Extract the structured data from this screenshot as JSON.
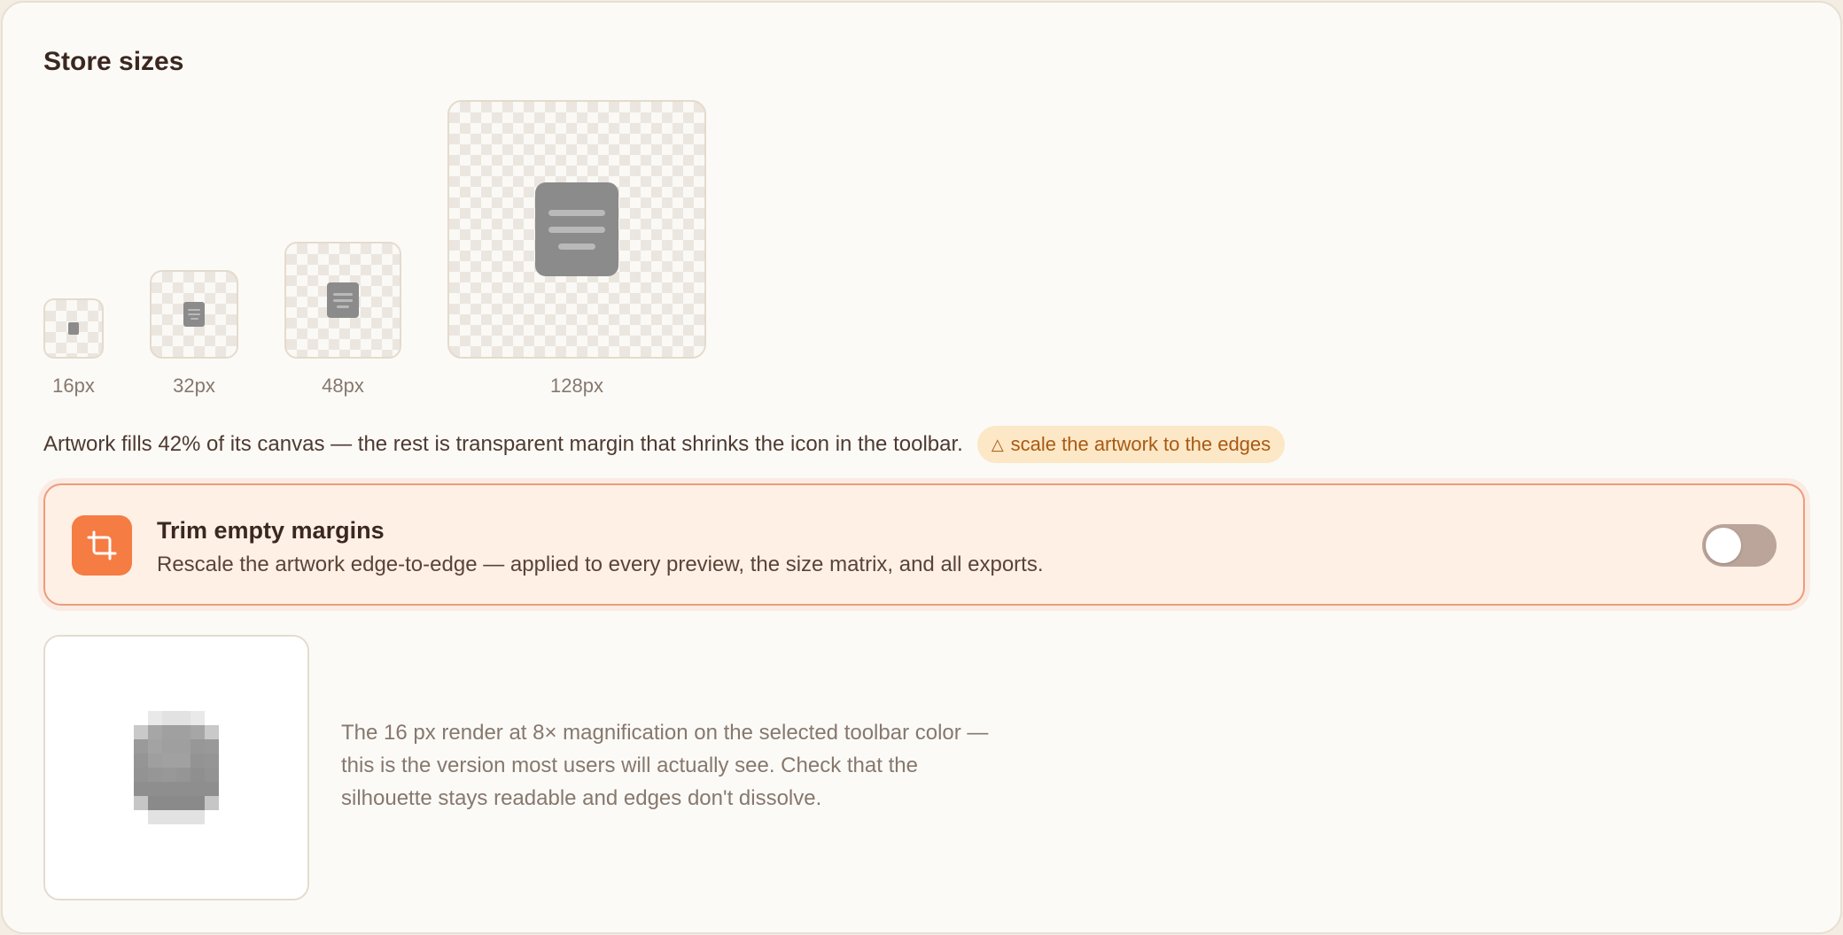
{
  "section": {
    "title": "Store sizes"
  },
  "sizes": [
    {
      "label": "16px"
    },
    {
      "label": "32px"
    },
    {
      "label": "48px"
    },
    {
      "label": "128px"
    }
  ],
  "notice": {
    "text": "Artwork fills 42% of its canvas — the rest is transparent margin that shrinks the icon in the toolbar.",
    "pill_icon": "△",
    "pill_label": "scale the artwork to the edges",
    "pill_color": "#a85a12",
    "pill_bg": "#fce7c6"
  },
  "trim": {
    "icon": "crop-icon",
    "title": "Trim empty margins",
    "description": "Rescale the artwork edge-to-edge — applied to every preview, the size matrix, and all exports.",
    "toggle_on": false,
    "accent": "#f57c43"
  },
  "preview": {
    "description": "The 16 px render at 8× magnification on the selected toolbar color — this is the version most users will actually see. Check that the silhouette stays readable and edges don't dissolve."
  },
  "pixels": [
    [
      "#ffffff",
      "#e9e9e9",
      "#e2e2e2",
      "#e2e2e2",
      "#e9e9e9",
      "#ffffff"
    ],
    [
      "#c9c9c9",
      "#a6a6a6",
      "#a0a0a0",
      "#a0a0a0",
      "#a6a6a6",
      "#c9c9c9"
    ],
    [
      "#9a9a9a",
      "#a3a3a3",
      "#9f9f9f",
      "#9f9f9f",
      "#979797",
      "#999999"
    ],
    [
      "#959595",
      "#9f9f9f",
      "#a1a1a1",
      "#a1a1a1",
      "#939393",
      "#959595"
    ],
    [
      "#939393",
      "#969696",
      "#989898",
      "#959595",
      "#8f8f8f",
      "#939393"
    ],
    [
      "#8e8e8e",
      "#8e8e8e",
      "#8e8e8e",
      "#8e8e8e",
      "#8e8e8e",
      "#8e8e8e"
    ],
    [
      "#c6c6c6",
      "#8a8a8a",
      "#8a8a8a",
      "#8a8a8a",
      "#8a8a8a",
      "#c6c6c6"
    ],
    [
      "#ffffff",
      "#e2e2e2",
      "#e2e2e2",
      "#e2e2e2",
      "#e2e2e2",
      "#ffffff"
    ]
  ]
}
